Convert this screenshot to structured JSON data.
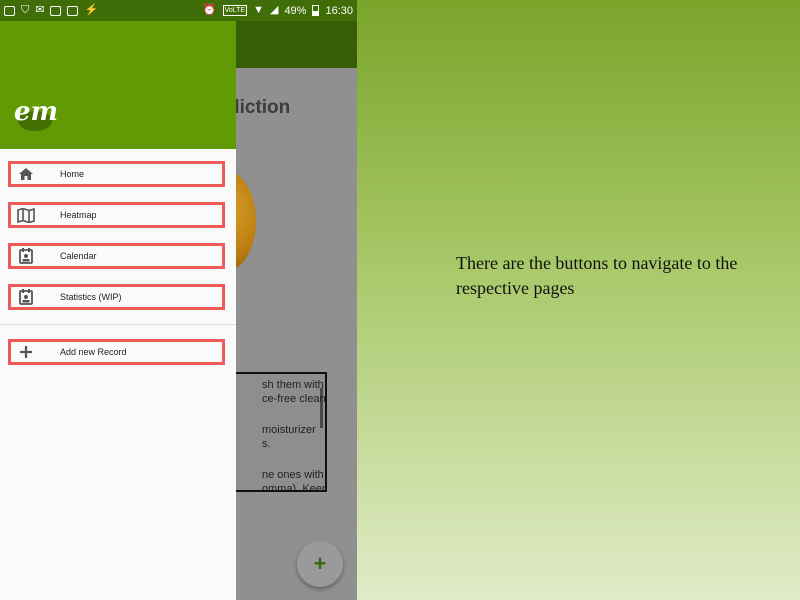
{
  "status_bar": {
    "battery": "49%",
    "time": "16:30",
    "network_badge": "VoLTE"
  },
  "background_app": {
    "title_fragment": "diction",
    "text_lines": [
      "sh them with",
      "ce-free cleanser.",
      "",
      "moisturizer",
      "s.",
      "",
      "ne ones with a",
      "omma). Keep"
    ],
    "fab_label": "+"
  },
  "drawer": {
    "logo_text": "em",
    "items": [
      {
        "label": "Home",
        "icon": "home-icon"
      },
      {
        "label": "Heatmap",
        "icon": "map-icon"
      },
      {
        "label": "Calendar",
        "icon": "calendar-icon"
      },
      {
        "label": "Statistics (WIP)",
        "icon": "stats-icon"
      }
    ],
    "add_item": {
      "label": "Add new Record",
      "icon": "plus-icon"
    }
  },
  "annotation": {
    "text": "There are the buttons to navigate to the respective pages"
  },
  "colors": {
    "header_green": "#629a06",
    "status_green": "#3f6d08",
    "highlight_red": "#ec5a5a"
  }
}
